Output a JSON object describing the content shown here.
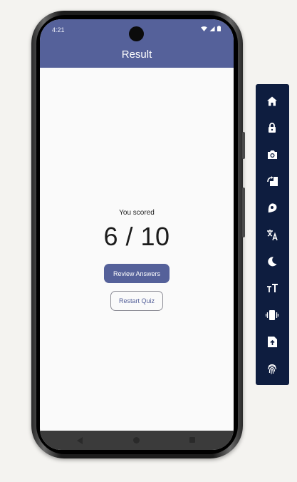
{
  "status_bar": {
    "time": "4:21"
  },
  "app_bar": {
    "title": "Result"
  },
  "result": {
    "scored_label": "You scored",
    "score_text": "6 / 10",
    "score": 6,
    "total": 10
  },
  "buttons": {
    "review_label": "Review Answers",
    "restart_label": "Restart Quiz"
  },
  "colors": {
    "app_bar": "#55619a",
    "primary_button": "#55619a",
    "screen_background": "#fafafa",
    "toolbar": "#0e1d3f",
    "toolbar_icon": "#ffffff"
  },
  "toolbar": {
    "icons": [
      "home-icon",
      "lock-icon",
      "camera-icon",
      "rotate-icon",
      "location-icon",
      "translate-icon",
      "dark-mode-icon",
      "font-size-icon",
      "vibrate-icon",
      "upload-file-icon",
      "fingerprint-icon"
    ]
  }
}
